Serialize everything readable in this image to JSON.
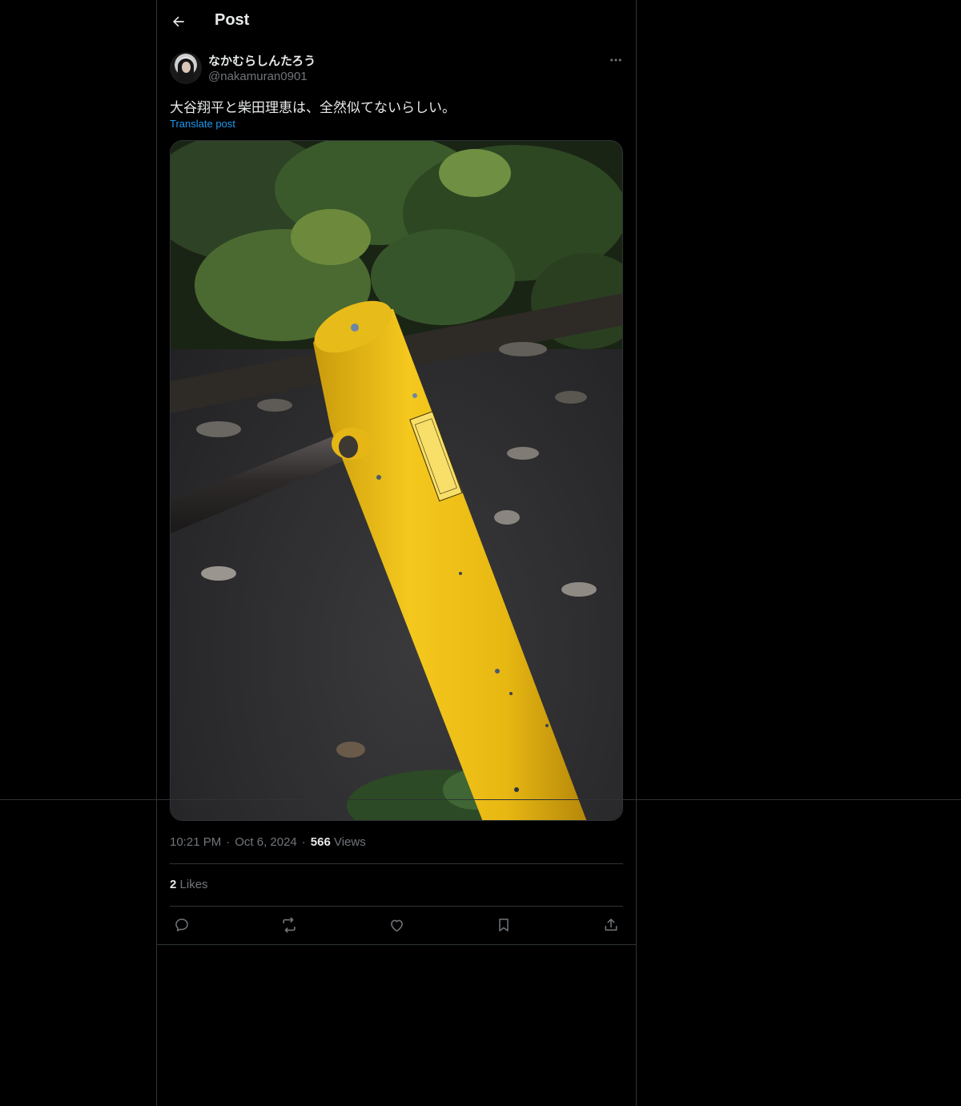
{
  "header": {
    "title": "Post",
    "back_icon": "arrow-left-icon"
  },
  "author": {
    "name": "なかむらしんたろう",
    "handle": "@nakamuran0901"
  },
  "post": {
    "text": "大谷翔平と柴田理恵は、全然似てないらしい。",
    "translate_label": "Translate post",
    "sticker_text": "大谷翔平と柴田理恵は、全然似てないらしい。"
  },
  "meta": {
    "time": "10:21 PM",
    "separator": "·",
    "date": "Oct 6, 2024",
    "views_count": "566",
    "views_label": "Views"
  },
  "stats": {
    "likes_count": "2",
    "likes_label": "Likes"
  },
  "actions": [
    "reply-icon",
    "repost-icon",
    "like-icon",
    "bookmark-icon",
    "share-icon"
  ],
  "colors": {
    "background": "#000000",
    "text": "#e7e9ea",
    "muted": "#71767b",
    "link": "#1d9bf0",
    "border": "#2f3336",
    "pole": "#f0c11a"
  }
}
